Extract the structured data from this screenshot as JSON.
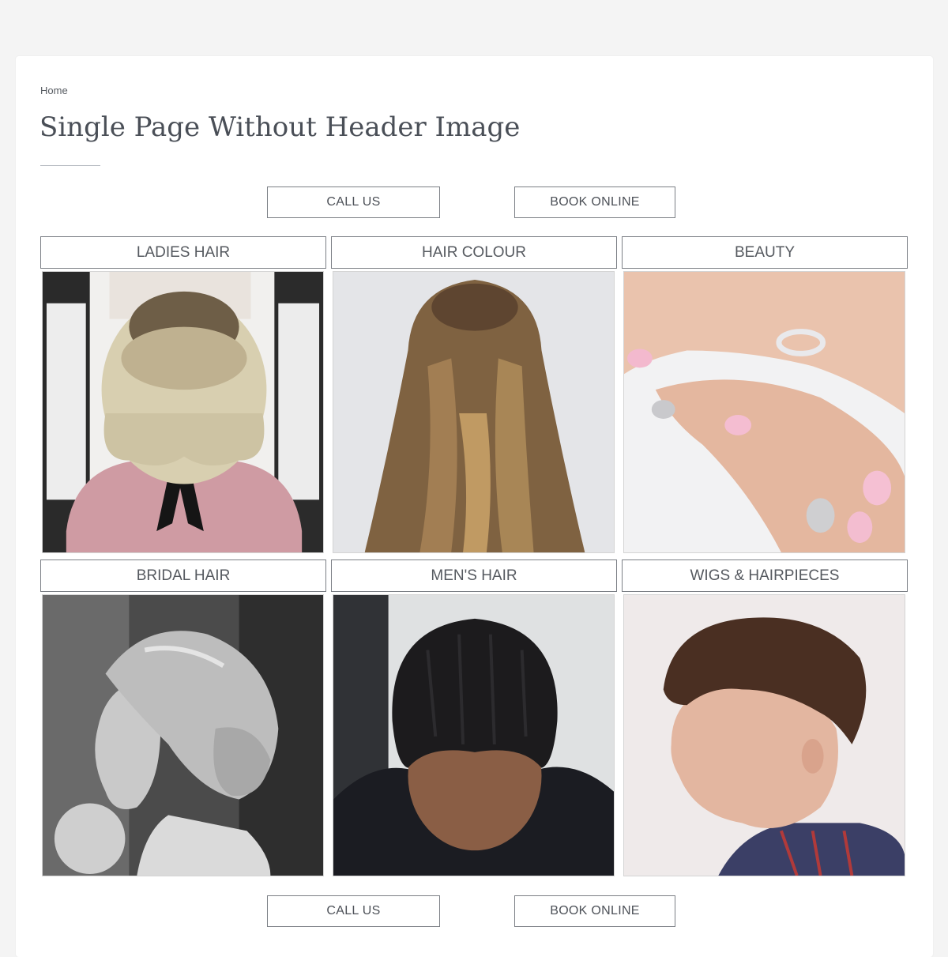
{
  "breadcrumb": {
    "home": "Home"
  },
  "page": {
    "title": "Single Page Without Header Image"
  },
  "top_actions": {
    "call": "CALL US",
    "book": "BOOK ONLINE"
  },
  "bottom_actions": {
    "call": "CALL US",
    "book": "BOOK ONLINE"
  },
  "services": [
    {
      "label": "LADIES HAIR",
      "image": "blonde-bob-back-photo"
    },
    {
      "label": "HAIR COLOUR",
      "image": "long-brown-waves-photo"
    },
    {
      "label": "BEAUTY",
      "image": "pink-nails-photo"
    },
    {
      "label": "BRIDAL HAIR",
      "image": "bridal-updo-photo"
    },
    {
      "label": "MEN'S HAIR",
      "image": "mens-crop-photo"
    },
    {
      "label": "WIGS & HAIRPIECES",
      "image": "mens-quiff-photo"
    }
  ]
}
